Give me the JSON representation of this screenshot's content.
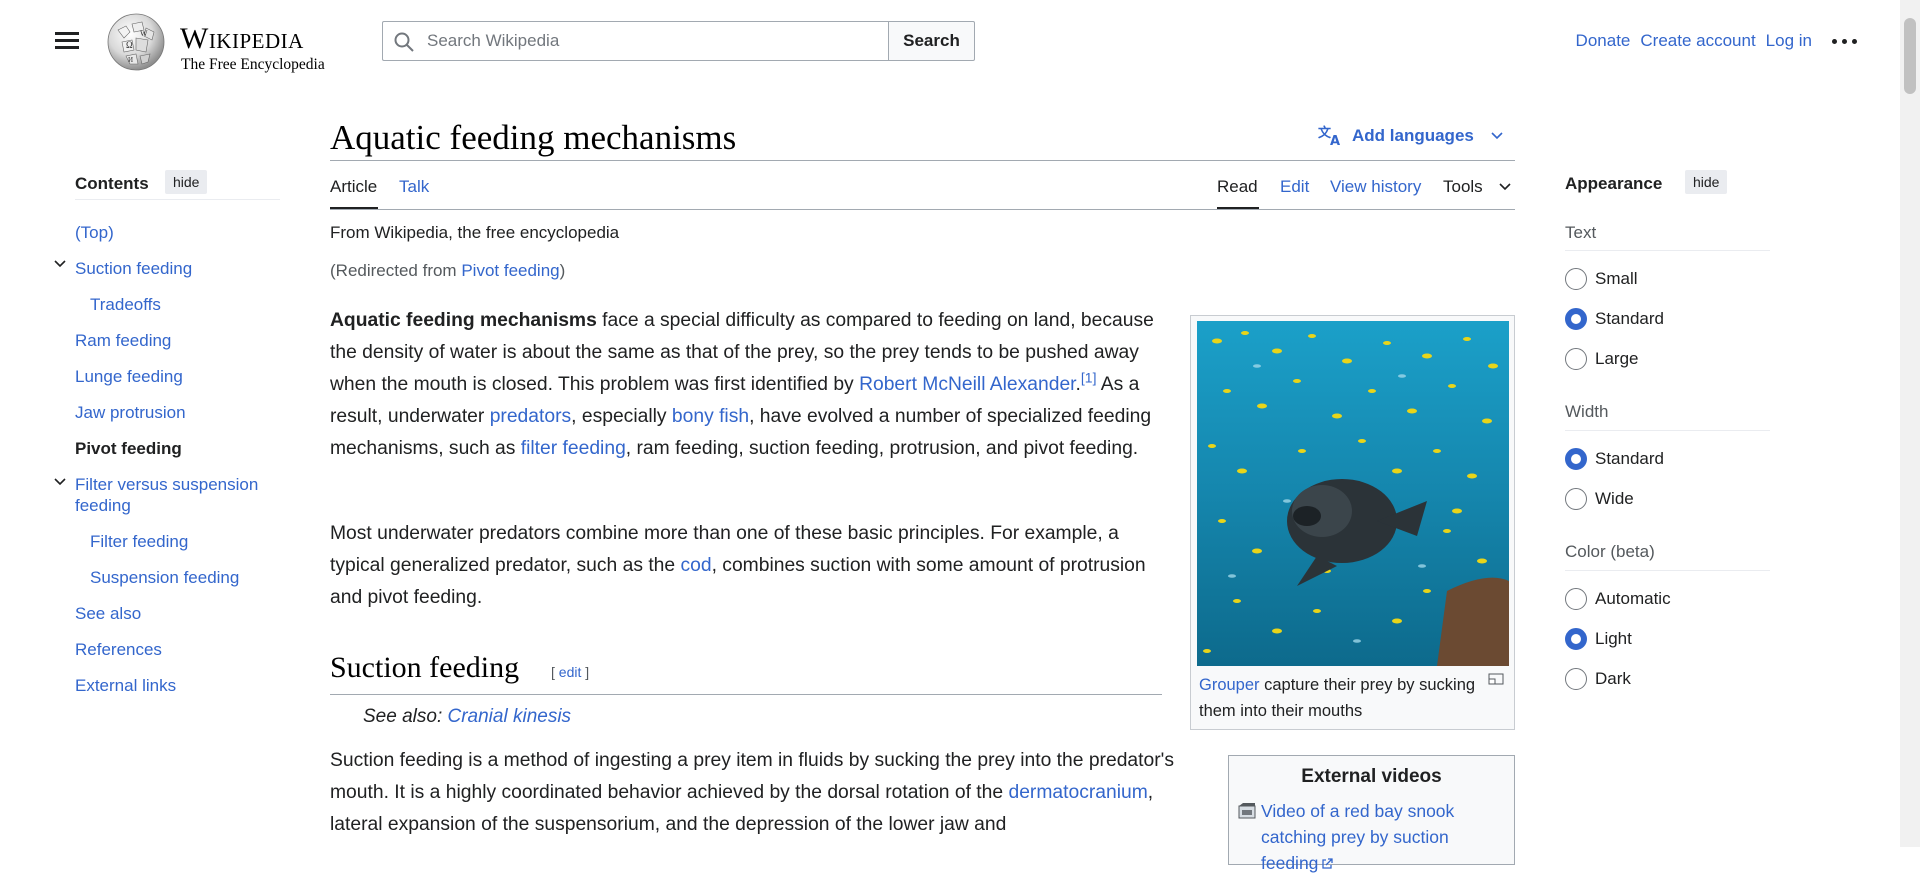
{
  "header": {
    "wordmark": "Wikipedia",
    "tagline": "The Free Encyclopedia",
    "search_placeholder": "Search Wikipedia",
    "search_button": "Search",
    "donate": "Donate",
    "create_account": "Create account",
    "log_in": "Log in",
    "icons": [
      "menu-icon",
      "wikipedia-globe-logo",
      "search-icon",
      "more-icon"
    ]
  },
  "toc": {
    "title": "Contents",
    "hide": "hide",
    "items": [
      {
        "label": "(Top)"
      },
      {
        "label": "Suction feeding"
      },
      {
        "label": "Tradeoffs"
      },
      {
        "label": "Ram feeding"
      },
      {
        "label": "Lunge feeding"
      },
      {
        "label": "Jaw protrusion"
      },
      {
        "label": "Pivot feeding"
      },
      {
        "label": "Filter versus suspension"
      },
      {
        "label": "feeding"
      },
      {
        "label": "Filter feeding"
      },
      {
        "label": "Suspension feeding"
      },
      {
        "label": "See also"
      },
      {
        "label": "References"
      },
      {
        "label": "External links"
      }
    ]
  },
  "article": {
    "title": "Aquatic feeding mechanisms",
    "add_languages": "Add languages",
    "tabs": {
      "article": "Article",
      "talk": "Talk",
      "read": "Read",
      "edit": "Edit",
      "view_history": "View history",
      "tools": "Tools"
    },
    "from": "From Wikipedia, the free encyclopedia",
    "redirected_prefix": "(Redirected from ",
    "redirected_link": "Pivot feeding",
    "redirected_suffix": ")",
    "p1": {
      "bold": "Aquatic feeding mechanisms",
      "t1": " face a special difficulty as compared to feeding on land, because the density of water is about the same as that of the prey, so the prey tends to be pushed away when the mouth is closed. This problem was first identified by ",
      "link1": "Robert McNeill Alexander",
      "t2": ".",
      "ref1": "[1]",
      "t3": " As a result, underwater ",
      "link2": "predators",
      "t4": ", especially ",
      "link3": "bony fish",
      "t5": ", have evolved a number of specialized feeding mechanisms, such as ",
      "link4": "filter feeding",
      "t6": ", ram feeding, suction feeding, protrusion, and pivot feeding."
    },
    "p2": {
      "t1": "Most underwater predators combine more than one of these basic principles. For example, a typical generalized predator, such as the ",
      "link1": "cod",
      "t2": ", combines suction with some amount of protrusion and pivot feeding."
    },
    "section_heading": "Suction feeding",
    "edit_bracket_open": "[ ",
    "edit_label": "edit",
    "edit_bracket_close": " ]",
    "see_also_prefix": "See also: ",
    "see_also_link": "Cranial kinesis",
    "p3": {
      "t1": "Suction feeding is a method of ingesting a prey item in fluids by sucking the prey into the predator's mouth. It is a highly coordinated behavior achieved by the dorsal rotation of the ",
      "link1": "dermatocranium",
      "t2": ", lateral expansion of the suspensorium, and the depression of the lower jaw and"
    },
    "thumb": {
      "caption_link": "Grouper",
      "caption_text": " capture their prey by sucking them into their mouths"
    },
    "external_videos": {
      "title": "External videos",
      "link": "Video of a red bay snook catching prey by suction feeding"
    }
  },
  "appearance": {
    "title": "Appearance",
    "hide": "hide",
    "text_label": "Text",
    "text_options": [
      "Small",
      "Standard",
      "Large"
    ],
    "text_selected": "Standard",
    "width_label": "Width",
    "width_options": [
      "Standard",
      "Wide"
    ],
    "width_selected": "Standard",
    "color_label": "Color (beta)",
    "color_options": [
      "Automatic",
      "Light",
      "Dark"
    ],
    "color_selected": "Light"
  },
  "colors": {
    "link": "#3366cc",
    "text": "#202122",
    "radio_checked": "#3366cc"
  }
}
